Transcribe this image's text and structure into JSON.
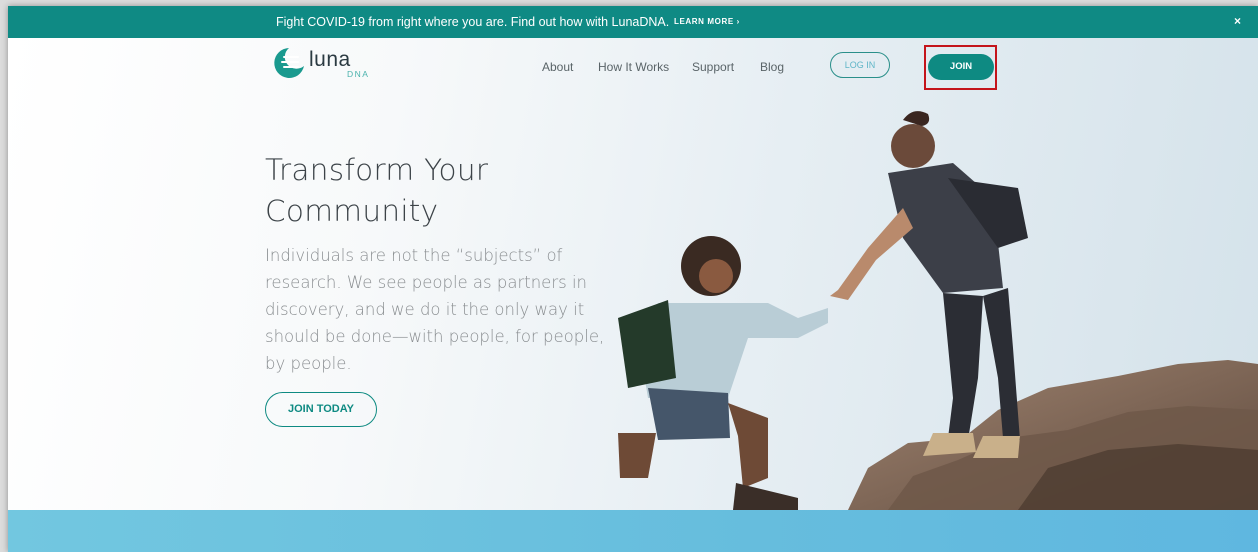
{
  "banner": {
    "message": "Fight COVID-19 from right where you are. Find out how with LunaDNA.",
    "link_label": "LEARN MORE ›",
    "close_label": "×"
  },
  "header": {
    "logo_word": "luna",
    "logo_sub": "DNA",
    "nav": [
      {
        "label": "About"
      },
      {
        "label": "How It Works"
      },
      {
        "label": "Support"
      },
      {
        "label": "Blog"
      }
    ],
    "login_label": "LOG IN",
    "join_label": "JOIN"
  },
  "hero": {
    "headline_line1": "Transform Your",
    "headline_line2": "Community",
    "body": "Individuals are not the “subjects” of research. We see people as partners in discovery, and we do it the only way it should be done—with people, for people, by people.",
    "cta_label": "JOIN TODAY"
  },
  "colors": {
    "brand_teal": "#0e8a82",
    "banner_teal": "#0f8a84",
    "highlight_red": "#c4141b",
    "footer_blue": "#66bddd"
  },
  "icons": [
    "luna-logo-icon",
    "close-icon",
    "chevron-right-icon"
  ]
}
